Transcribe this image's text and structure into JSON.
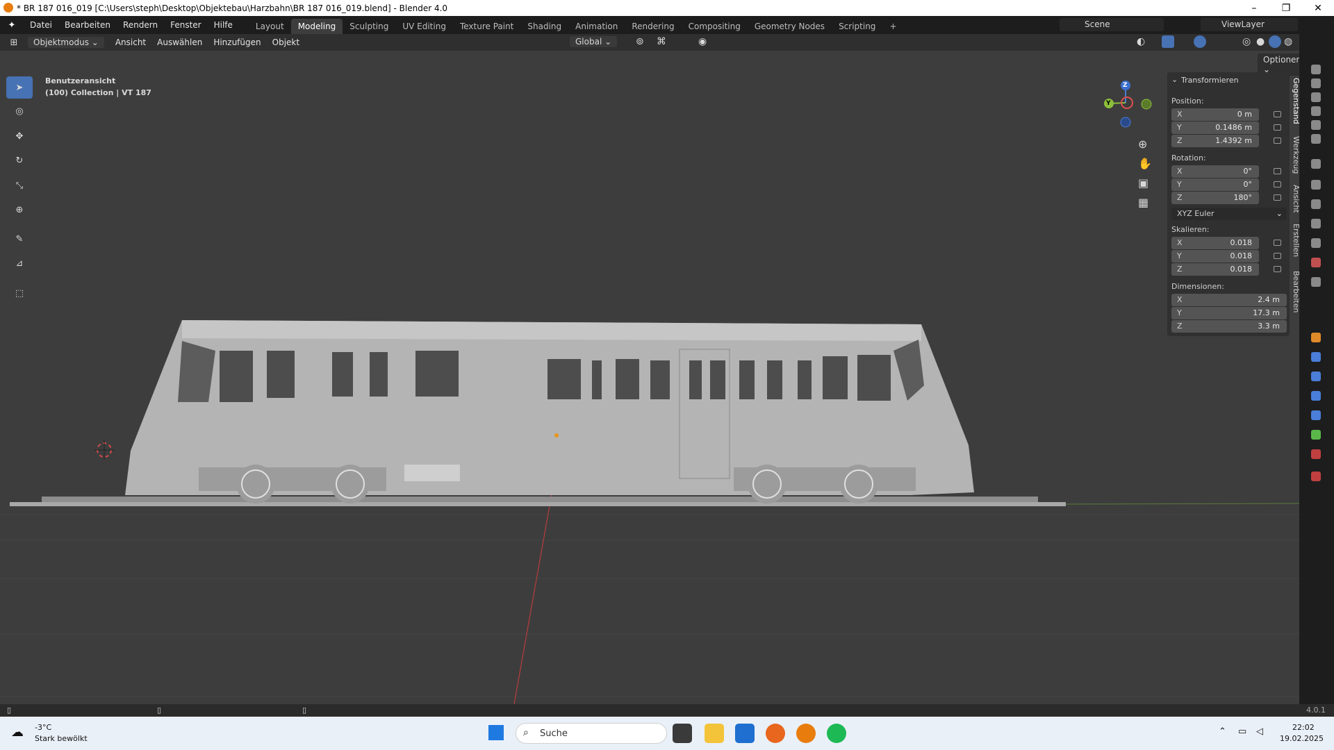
{
  "titlebar": {
    "title": "* BR 187 016_019 [C:\\Users\\steph\\Desktop\\Objektebau\\Harzbahn\\BR 187 016_019.blend] - Blender 4.0",
    "minimize": "–",
    "maximize": "❐",
    "close": "✕"
  },
  "menubar": {
    "items": [
      "Datei",
      "Bearbeiten",
      "Rendern",
      "Fenster",
      "Hilfe"
    ],
    "workspaces": [
      "Layout",
      "Modeling",
      "Sculpting",
      "UV Editing",
      "Texture Paint",
      "Shading",
      "Animation",
      "Rendering",
      "Compositing",
      "Geometry Nodes",
      "Scripting"
    ],
    "add_tab": "+",
    "scene": "Scene",
    "viewlayer": "ViewLayer"
  },
  "header": {
    "mode": "Objektmodus",
    "items": [
      "Ansicht",
      "Auswählen",
      "Hinzufügen",
      "Objekt"
    ],
    "orientation": "Global",
    "options": "Optionen"
  },
  "viewport": {
    "view_name": "Benutzeransicht",
    "collection": "(100) Collection | VT 187"
  },
  "gizmo": {
    "z": "Z",
    "y": "Y"
  },
  "npanel": {
    "section": "Transformieren",
    "position_label": "Position:",
    "position": [
      {
        "axis": "X",
        "value": "0 m"
      },
      {
        "axis": "Y",
        "value": "0.1486 m"
      },
      {
        "axis": "Z",
        "value": "1.4392 m"
      }
    ],
    "rotation_label": "Rotation:",
    "rotation": [
      {
        "axis": "X",
        "value": "0°"
      },
      {
        "axis": "Y",
        "value": "0°"
      },
      {
        "axis": "Z",
        "value": "180°"
      }
    ],
    "rotation_mode": "XYZ Euler",
    "scale_label": "Skalieren:",
    "scale": [
      {
        "axis": "X",
        "value": "0.018"
      },
      {
        "axis": "Y",
        "value": "0.018"
      },
      {
        "axis": "Z",
        "value": "0.018"
      }
    ],
    "dimensions_label": "Dimensionen:",
    "dimensions": [
      {
        "axis": "X",
        "value": "2.4 m"
      },
      {
        "axis": "Y",
        "value": "17.3 m"
      },
      {
        "axis": "Z",
        "value": "3.3 m"
      }
    ]
  },
  "sidetabs": [
    "Gegenstand",
    "Werkzeug",
    "Ansicht",
    "Erstellen",
    "Bearbeiten"
  ],
  "statusbar": {
    "version": "4.0.1"
  },
  "taskbar": {
    "temp": "-3°C",
    "weather": "Stark bewölkt",
    "search": "Suche",
    "time": "22:02",
    "date": "19.02.2025"
  }
}
